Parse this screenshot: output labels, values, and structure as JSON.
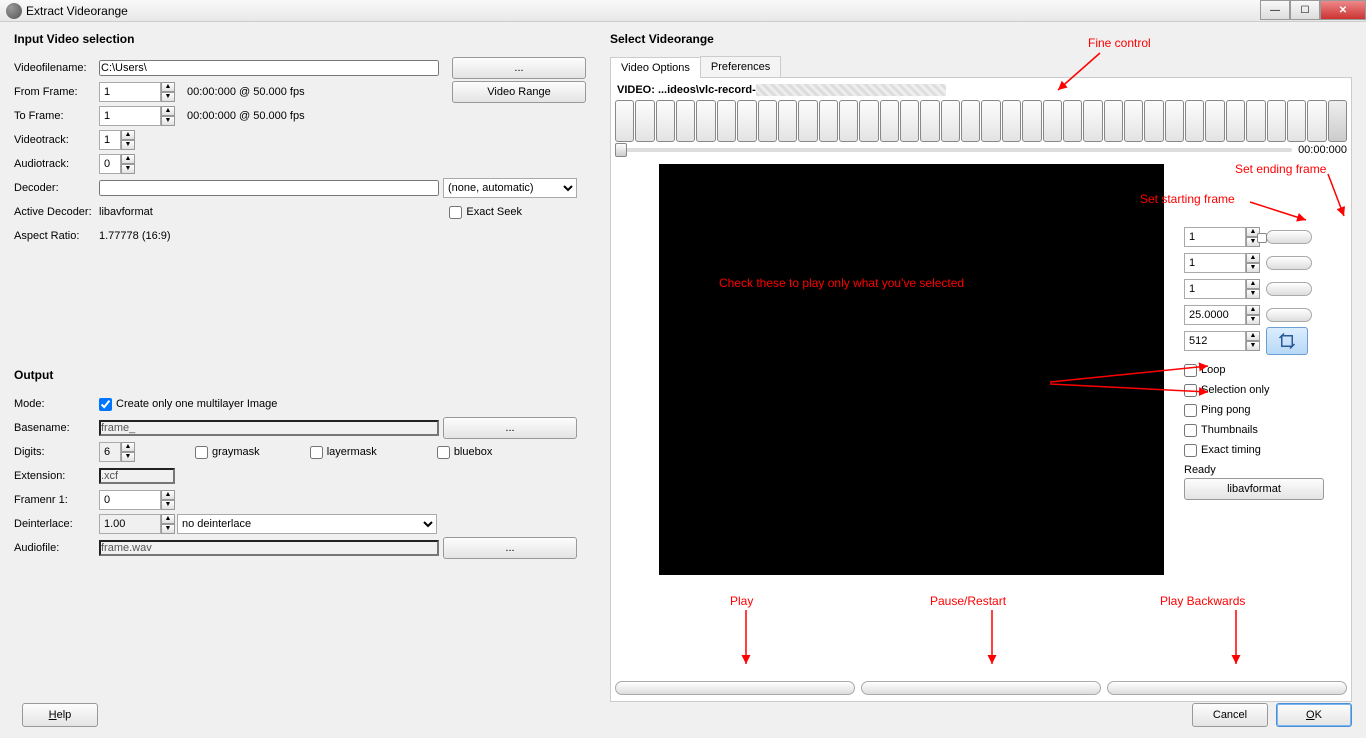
{
  "window": {
    "title": "Extract Videorange"
  },
  "left": {
    "section1": "Input Video selection",
    "videofilename_label": "Videofilename:",
    "videofilename": "C:\\Users\\",
    "browse": "...",
    "from_frame_label": "From Frame:",
    "from_frame": "1",
    "from_frame_time": "00:00:000 @ 50.000 fps",
    "video_range_btn": "Video Range",
    "to_frame_label": "To Frame:",
    "to_frame": "1",
    "to_frame_time": "00:00:000 @ 50.000 fps",
    "videotrack_label": "Videotrack:",
    "videotrack": "1",
    "audiotrack_label": "Audiotrack:",
    "audiotrack": "0",
    "decoder_label": "Decoder:",
    "decoder_option": "(none, automatic)",
    "active_decoder_label": "Active Decoder:",
    "active_decoder": "libavformat",
    "exact_seek": "Exact Seek",
    "aspect_label": "Aspect Ratio:",
    "aspect": "1.77778 (16:9)",
    "section2": "Output",
    "mode_label": "Mode:",
    "mode_check": "Create only one multilayer Image",
    "basename_label": "Basename:",
    "basename": "frame_",
    "basename_btn": "...",
    "digits_label": "Digits:",
    "digits": "6",
    "graymask": "graymask",
    "layermask": "layermask",
    "bluebox": "bluebox",
    "extension_label": "Extension:",
    "extension": ".xcf",
    "framenr_label": "Framenr 1:",
    "framenr": "0",
    "deinterlace_label": "Deinterlace:",
    "deinterlace_val": "1.00",
    "deinterlace_sel": "no deinterlace",
    "audiofile_label": "Audiofile:",
    "audiofile": "frame.wav",
    "audiofile_btn": "..."
  },
  "right": {
    "section": "Select Videorange",
    "tab1": "Video Options",
    "tab2": "Preferences",
    "video_label_prefix": "VIDEO: ...ideos\\vlc-record-",
    "time_end": "00:00:000",
    "spin1": "1",
    "spin2": "1",
    "spin3": "1",
    "spin4": "25.0000",
    "spin5": "512",
    "chk_loop": "Loop",
    "chk_selection": "Selection only",
    "chk_pingpong": "Ping pong",
    "chk_thumbnails": "Thumbnails",
    "chk_exact": "Exact timing",
    "status": "Ready",
    "format_btn": "libavformat"
  },
  "annotations": {
    "fine_control": "Fine control",
    "set_ending": "Set ending frame",
    "set_starting": "Set starting frame",
    "check_these": "Check these to play only what you've selected",
    "play": "Play",
    "pause": "Pause/Restart",
    "play_back": "Play Backwards"
  },
  "bottom": {
    "help": "Help",
    "cancel": "Cancel",
    "ok": "OK"
  }
}
